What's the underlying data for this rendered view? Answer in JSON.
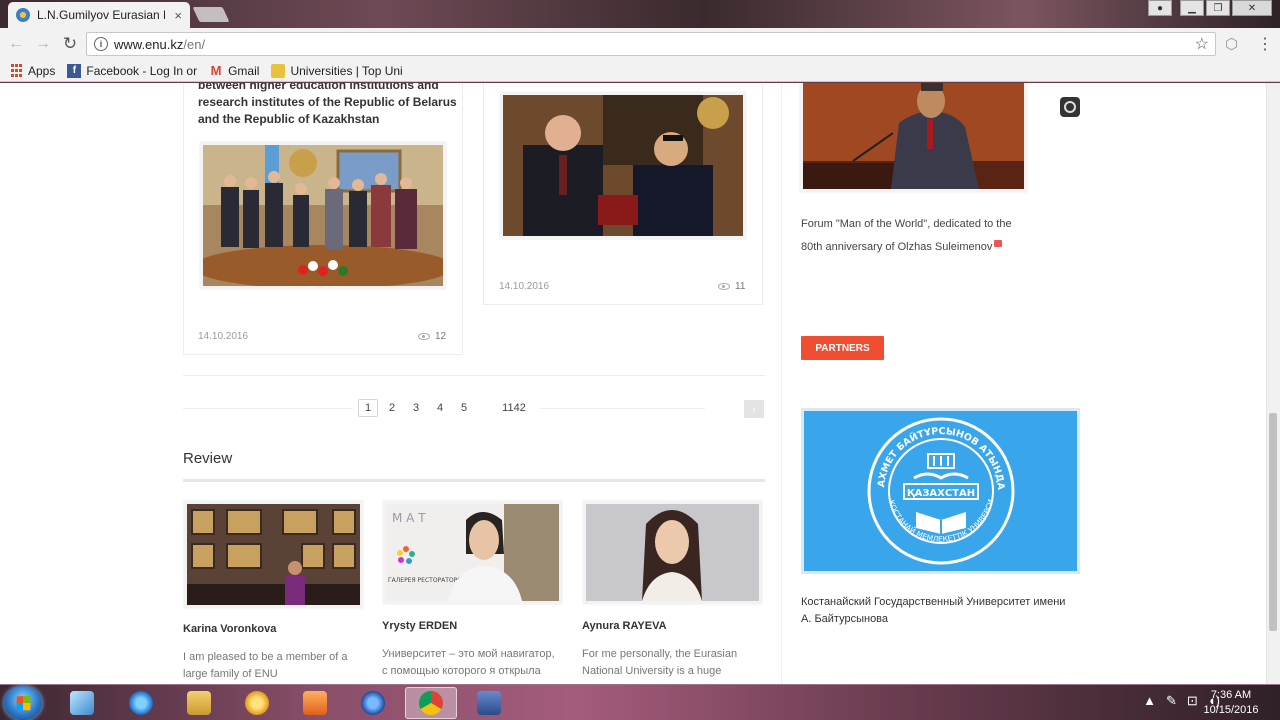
{
  "browser": {
    "tab_title": "L.N.Gumilyov Eurasian N",
    "tab_close": "×",
    "url_host": "www.enu.kz",
    "url_path": "/en/",
    "bookmarks": [
      {
        "label": "Apps",
        "icon": "apps-grid-icon"
      },
      {
        "label": "Facebook - Log In or",
        "fade": "",
        "icon": "facebook-icon"
      },
      {
        "label": "Gmail",
        "icon": "gmail-icon"
      },
      {
        "label": "Universities | Top Uni",
        "fade": "",
        "icon": "universities-icon"
      }
    ]
  },
  "news": {
    "card1": {
      "title": "between higher education institutions and research institutes of the Republic of Belarus and the Republic of Kazakhstan",
      "date": "14.10.2016",
      "views": "12"
    },
    "card2": {
      "date": "14.10.2016",
      "views": "11"
    }
  },
  "sidebar": {
    "forum_caption_line1": "Forum \"Man of the World\", dedicated to the",
    "forum_caption_line2": "80th anniversary of Olzhas Suleimenov",
    "partners_label": "PARTNERS",
    "uni_logo_top": "АХМЕТ БАЙТҰРСЫНОВ АТЫНДАҒЫ",
    "uni_logo_center": "ҚАЗАХСТАН",
    "uni_logo_bottom": "КОСТАНАЙ МЕМЛЕКЕТТІК УНИВЕРСИТЕТІ",
    "uni_caption": " Костанайский Государственный Университет имени А. Байтурсынова"
  },
  "pagination": {
    "pages": [
      "1",
      "2",
      "3",
      "4",
      "5"
    ],
    "last_page": "1142",
    "next": "›"
  },
  "review": {
    "title": "Review",
    "items": [
      {
        "name": "Karina Voronkova",
        "text": "I am pleased to be a member of a large family of ENU"
      },
      {
        "name": "Yrysty ERDEN",
        "text": "Университет – это мой навигатор, с помощью которого я открыла"
      },
      {
        "name": "Aynura RAYEVA",
        "text": "For me personally, the Eurasian National University is a huge"
      }
    ],
    "photo2_lettering": "М  А  Т",
    "photo2_sign": "ГАЛЕРЕЯ РЕСТОРАТОРОВ"
  },
  "taskbar": {
    "time": "7:36 AM",
    "date": "10/15/2016"
  },
  "colors": {
    "accent": "#f04e30",
    "logo_blue": "#39a6ec"
  }
}
